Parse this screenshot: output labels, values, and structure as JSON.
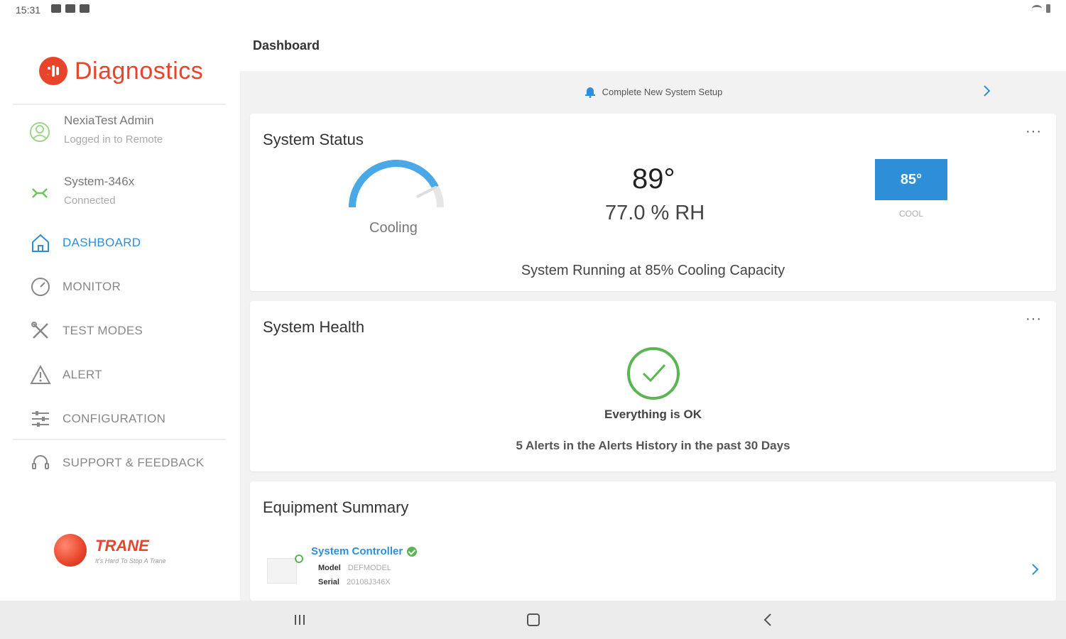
{
  "status_bar": {
    "time": "15:31"
  },
  "brand": {
    "name": "Diagnostics"
  },
  "account": {
    "user": "NexiaTest Admin",
    "user_status": "Logged in to Remote Diagnostics",
    "system": "System-346x",
    "system_status": "Connected"
  },
  "nav": {
    "dashboard": "DASHBOARD",
    "monitor": "MONITOR",
    "test_modes": "TEST MODES",
    "alert": "ALERT",
    "configuration": "CONFIGURATION",
    "support": "SUPPORT & FEEDBACK"
  },
  "footer_brand": {
    "name": "TRANE",
    "tagline": "It's Hard To Stop A Trane"
  },
  "page": {
    "title": "Dashboard"
  },
  "setup_banner": {
    "label": "Complete New System Setup"
  },
  "system_status": {
    "title": "System Status",
    "mode": "Cooling",
    "temperature": "89°",
    "humidity": "77.0 % RH",
    "setpoint": "85°",
    "setpoint_mode": "COOL",
    "running": "System Running at 85% Cooling Capacity",
    "capacity_fraction": 0.85
  },
  "system_health": {
    "title": "System Health",
    "state": "Everything is OK",
    "alerts": "5 Alerts in the Alerts History in the past 30 Days"
  },
  "equipment": {
    "title": "Equipment Summary",
    "item_name": "System Controller",
    "model_label": "Model",
    "model_value": "DEFMODEL",
    "serial_label": "Serial",
    "serial_value": "20108J346X"
  },
  "more_label": "···",
  "colors": {
    "accent": "#2e8fd8",
    "brand": "#e8442c",
    "ok": "#5ab552"
  }
}
